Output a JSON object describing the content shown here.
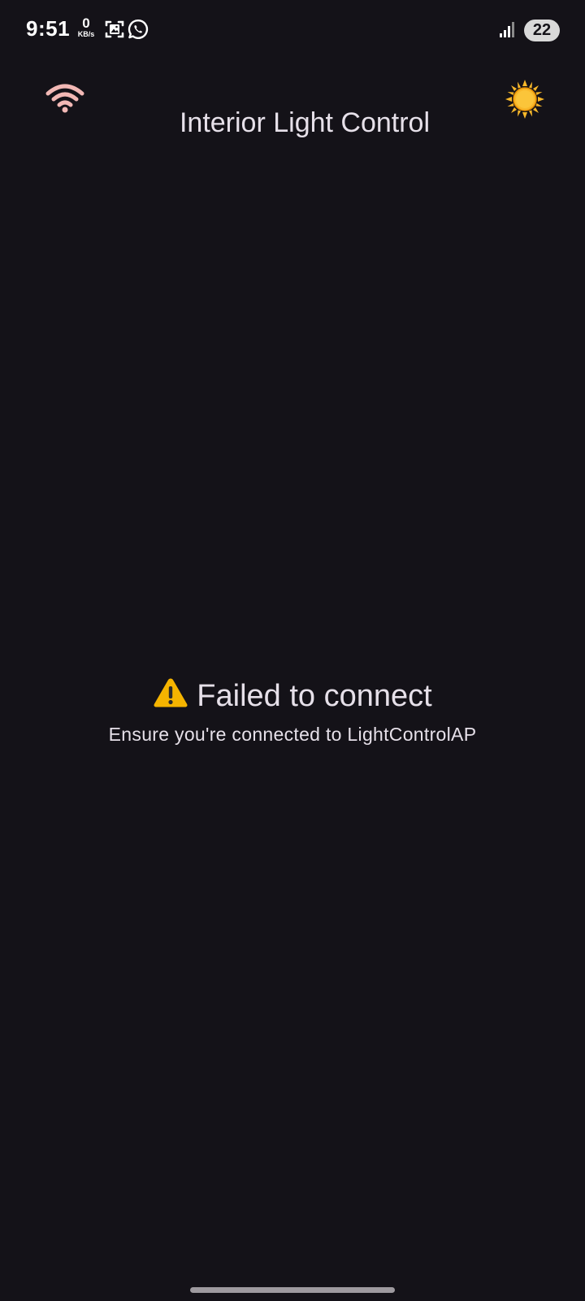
{
  "status_bar": {
    "time": "9:51",
    "net_speed_value": "0",
    "net_speed_unit": "KB/s",
    "battery_level": "22",
    "icons": [
      "gallery-notification-icon",
      "whatsapp-icon",
      "signal-icon",
      "battery-icon"
    ]
  },
  "header": {
    "title": "Interior Light Control",
    "wifi_icon": "wifi-icon",
    "theme_icon": "sun-icon"
  },
  "error": {
    "icon": "warning-icon",
    "title": "Failed to connect",
    "hint": "Ensure you're connected to LightControlAP"
  },
  "colors": {
    "background": "#141218",
    "text": "#e6e0e9",
    "wifi_accent": "#f2b8b5",
    "sun": "#f9b82a",
    "warning": "#f5b400"
  }
}
